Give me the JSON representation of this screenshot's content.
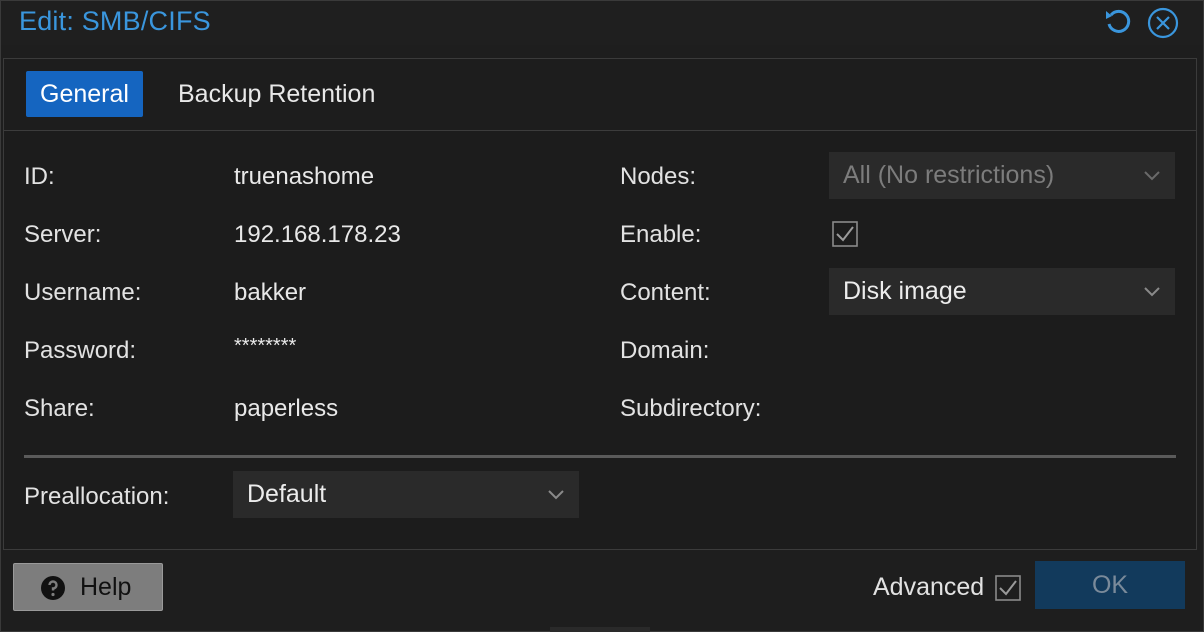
{
  "window": {
    "title": "Edit: SMB/CIFS"
  },
  "toolbar": {
    "reset_icon": "reset-icon",
    "close_icon": "close-icon"
  },
  "tabs": [
    {
      "label": "General",
      "active": true
    },
    {
      "label": "Backup Retention",
      "active": false
    }
  ],
  "fields": {
    "id": {
      "label": "ID:",
      "value": "truenashome"
    },
    "server": {
      "label": "Server:",
      "value": "192.168.178.23"
    },
    "username": {
      "label": "Username:",
      "value": "bakker"
    },
    "password": {
      "label": "Password:",
      "value": "********"
    },
    "share": {
      "label": "Share:",
      "value": "paperless"
    },
    "nodes": {
      "label": "Nodes:",
      "value": "All (No restrictions)",
      "disabled": true
    },
    "enable": {
      "label": "Enable:",
      "checked": true
    },
    "content": {
      "label": "Content:",
      "value": "Disk image"
    },
    "domain": {
      "label": "Domain:",
      "value": ""
    },
    "subdirectory": {
      "label": "Subdirectory:",
      "value": ""
    },
    "preallocation": {
      "label": "Preallocation:",
      "value": "Default"
    }
  },
  "footer": {
    "help_label": "Help",
    "advanced_label": "Advanced",
    "advanced_checked": true,
    "ok_label": "OK"
  },
  "colors": {
    "accent": "#1565c0",
    "title": "#3a96dd",
    "ok_button": "#123a5c"
  }
}
